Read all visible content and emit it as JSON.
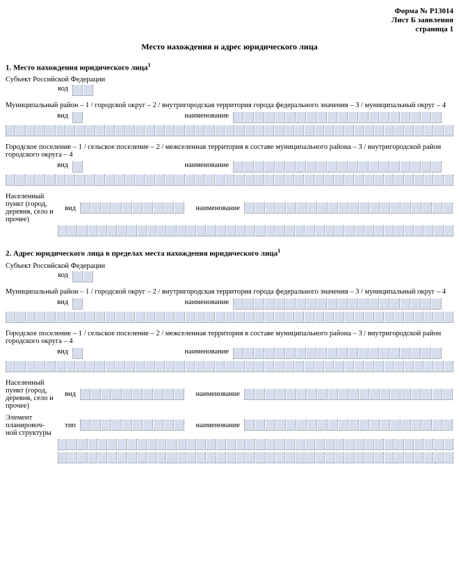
{
  "header": {
    "form": "Форма № Р13014",
    "sheet": "Лист Б заявления",
    "page": "страница 1"
  },
  "title": "Место нахождения и адрес юридического лица",
  "section1": {
    "heading_prefix": "1. Место нахождения юридического лица",
    "heading_sup": "1",
    "subject": "Субъект Российской Федерации",
    "code_label": "код",
    "municipal_line": "Муниципальный район – 1 / городской округ – 2 / внутригородская территория города федерального значения – 3 / муниципальный округ – 4",
    "vid": "вид",
    "naim": "наименование",
    "urban_line": "Городское поселение – 1 / сельское поселение – 2 / межселенная территория в составе муниципального района – 3 / внутригородской район городского округа – 4",
    "settlement": "Населенный пункт (город, деревня, село и прочее)"
  },
  "section2": {
    "heading_prefix": "2. Адрес юридического лица в пределах места нахождения юридического лица",
    "heading_sup": "1",
    "subject": "Субъект Российской Федерации",
    "code_label": "код",
    "municipal_line": "Муниципальный район – 1 / городской округ – 2 / внутригородская территория города федерального значения – 3 / муниципальный округ – 4",
    "vid": "вид",
    "naim": "наименование",
    "urban_line": "Городское поселение – 1 / сельское поселение – 2 / межселенная территория в составе муниципального района – 3 / внутригородской район городского округа – 4",
    "settlement": "Населенный пункт (город, деревня, село и прочее)",
    "plan_element": "Элемент планировоч-ной структуры",
    "type": "тип"
  }
}
